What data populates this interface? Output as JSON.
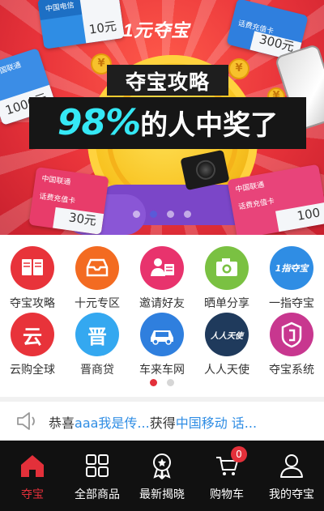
{
  "banner": {
    "logo": "1元夺宝",
    "headline": "夺宝攻略",
    "tagline_percent": "98%",
    "tagline_rest": "的人中奖了",
    "cards": {
      "blue_top": {
        "brand": "中国电信",
        "amount": "10元"
      },
      "blue_right": {
        "amount": "300元",
        "kind": "话费充值卡"
      },
      "blue_left": {
        "brand": "中国联通",
        "amount": "1000元"
      },
      "pink_left": {
        "brand": "中国联通",
        "amount": "30元",
        "kind": "话费充值卡"
      },
      "pink_right": {
        "brand": "中国联通",
        "amount": "100",
        "kind": "话费充值卡"
      }
    },
    "slide_count": 4,
    "active_slide": 1
  },
  "categories": [
    {
      "label": "夺宝攻略",
      "color": "#e8333a",
      "icon": "book-icon"
    },
    {
      "label": "十元专区",
      "color": "#f36b21",
      "icon": "tray-icon"
    },
    {
      "label": "邀请好友",
      "color": "#e8336d",
      "icon": "invite-icon"
    },
    {
      "label": "晒单分享",
      "color": "#7ac142",
      "icon": "camera-icon"
    },
    {
      "label": "一指夺宝",
      "color": "#2f8de4",
      "icon": "one-finger-logo",
      "glyph": "1指夺宝"
    },
    {
      "label": "云购全球",
      "color": "#e8333a",
      "icon": "cloud-char-icon",
      "glyph": "云"
    },
    {
      "label": "晋商贷",
      "color": "#34a8f0",
      "icon": "jinshang-icon",
      "glyph": "晋"
    },
    {
      "label": "车来车网",
      "color": "#2f7fde",
      "icon": "car-icon"
    },
    {
      "label": "人人天使",
      "color": "#1f3a5c",
      "icon": "angel-icon",
      "glyph": "人人天使"
    },
    {
      "label": "夺宝系统",
      "color": "#c8378f",
      "icon": "shield-icon"
    }
  ],
  "grid_pager": {
    "pages": 2,
    "active": 0
  },
  "notice": {
    "prefix": "恭喜",
    "user": "aaa我是传...",
    "middle": "获得",
    "prize": "中国移动 话..."
  },
  "tabbar": {
    "tabs": [
      {
        "label": "夺宝",
        "icon": "home-icon",
        "active": true
      },
      {
        "label": "全部商品",
        "icon": "grid-icon",
        "active": false
      },
      {
        "label": "最新揭晓",
        "icon": "award-icon",
        "active": false
      },
      {
        "label": "购物车",
        "icon": "cart-icon",
        "active": false,
        "badge": "0"
      },
      {
        "label": "我的夺宝",
        "icon": "user-icon",
        "active": false
      }
    ]
  },
  "colors": {
    "accent": "#e3303a",
    "link": "#2f8de4",
    "tabbar_bg": "#111111"
  }
}
